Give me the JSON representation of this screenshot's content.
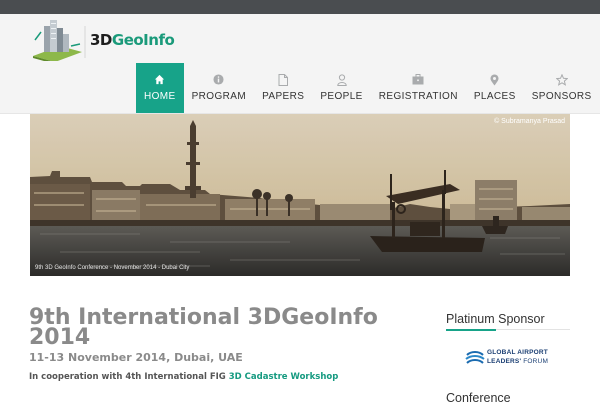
{
  "site": {
    "logo_text_prefix": "3D",
    "logo_text_suffix": "GeoInfo"
  },
  "nav": {
    "items": [
      {
        "label": "HOME",
        "icon": "home-icon"
      },
      {
        "label": "PROGRAM",
        "icon": "info-icon"
      },
      {
        "label": "PAPERS",
        "icon": "document-icon"
      },
      {
        "label": "PEOPLE",
        "icon": "user-icon"
      },
      {
        "label": "REGISTRATION",
        "icon": "briefcase-icon"
      },
      {
        "label": "PLACES",
        "icon": "map-pin-icon"
      },
      {
        "label": "SPONSORS",
        "icon": "star-icon"
      }
    ],
    "active": "HOME",
    "accent_color": "#17a389"
  },
  "hero": {
    "photo_credit": "© Subramanya Prasad",
    "caption": "9th 3D GeoInfo Conference - November 2014 - Dubai City"
  },
  "main": {
    "title": "9th International 3DGeoInfo 2014",
    "date": "11-13 November 2014, Dubai, UAE",
    "cooperation_text": "In cooperation with 4th International FIG",
    "cooperation_link": "3D Cadastre Workshop"
  },
  "sidebar": {
    "heading": "Platinum Sponsor",
    "sponsor_line1": "GLOBAL AIRPORT",
    "sponsor_line2_bold": "LEADERS'",
    "sponsor_line2_thin": "FORUM",
    "next_heading": "Conference"
  }
}
